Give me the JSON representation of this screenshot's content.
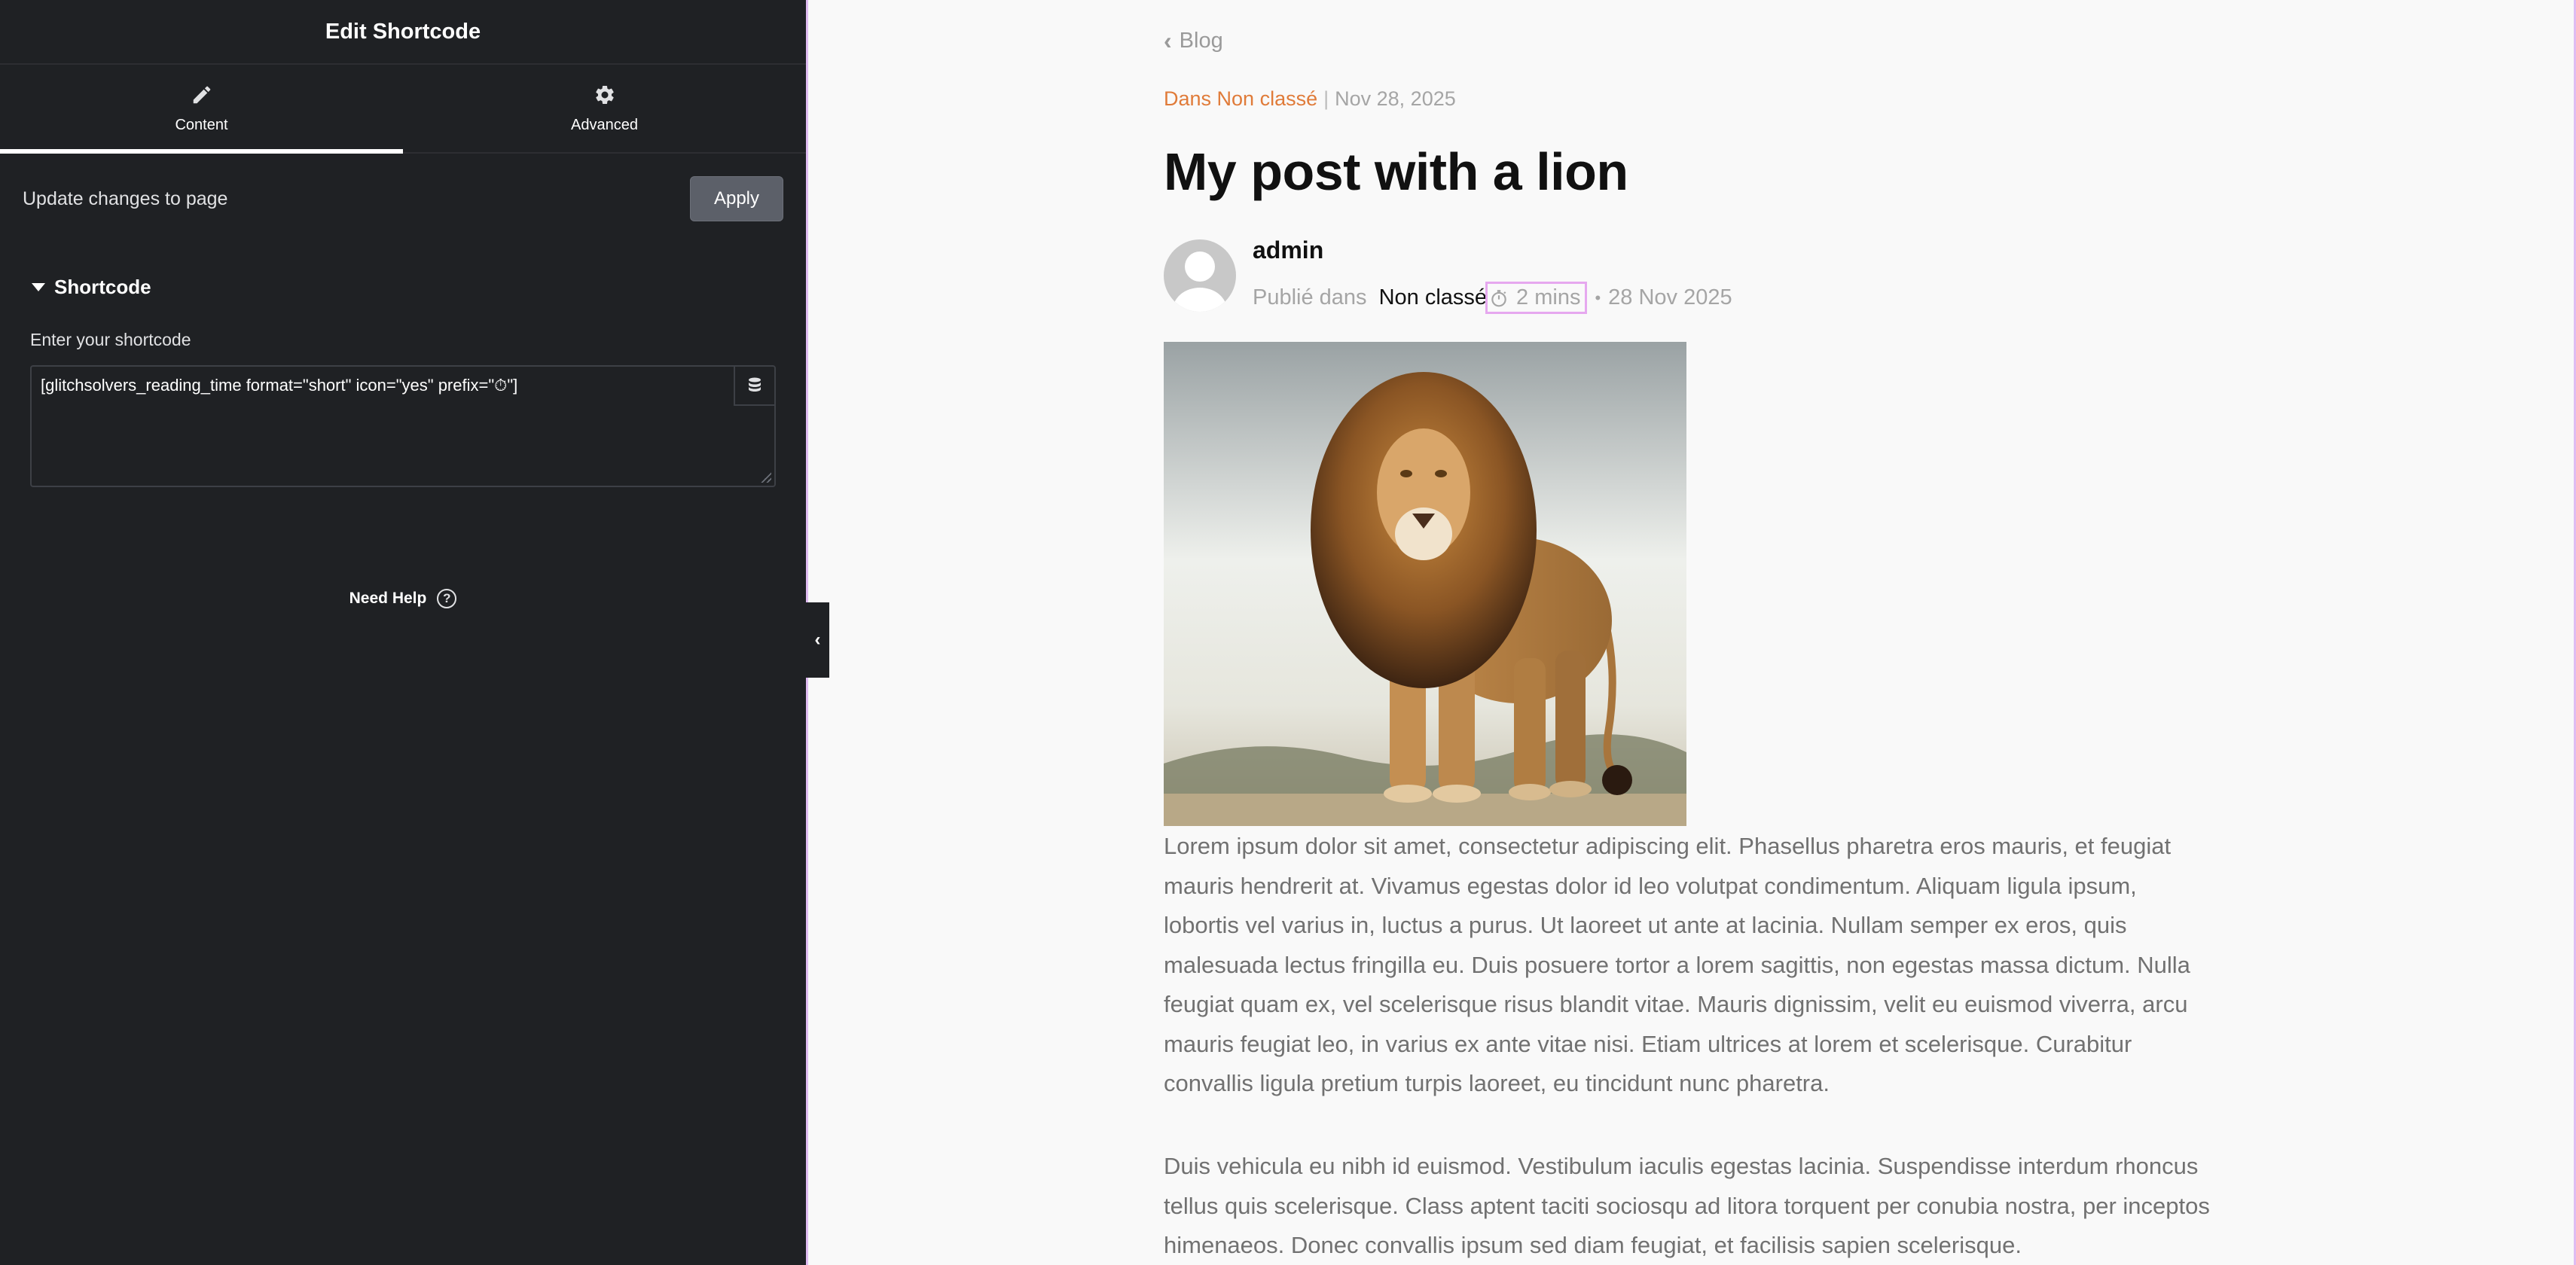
{
  "panel": {
    "title": "Edit Shortcode",
    "tabs": [
      {
        "label": "Content",
        "icon": "pencil-icon",
        "active": true
      },
      {
        "label": "Advanced",
        "icon": "gear-icon",
        "active": false
      }
    ],
    "update_label": "Update changes to page",
    "apply_label": "Apply",
    "section_title": "Shortcode",
    "field_label": "Enter your shortcode",
    "shortcode_value": "[glitchsolvers_reading_time format=\"short\" icon=\"yes\" prefix=\"⏱\"]",
    "help_label": "Need Help",
    "help_icon": "question-circle-icon",
    "collapse_icon": "chevron-left-icon"
  },
  "preview": {
    "back_label": "Blog",
    "category": "Dans Non classé",
    "meta_separator": "|",
    "date": "Nov 28, 2025",
    "title": "My post with a lion",
    "author": "admin",
    "published_in": "Publié dans",
    "byline_category": "Non classé",
    "reading_time": "2 mins",
    "byline_separator": "•",
    "byline_date": "28 Nov 2025",
    "image_subject": "lion",
    "paragraphs": [
      "Lorem ipsum dolor sit amet, consectetur adipiscing elit. Phasellus pharetra eros mauris, et feugiat mauris hendrerit at. Vivamus egestas dolor id leo volutpat condimentum. Aliquam ligula ipsum, lobortis vel varius in, luctus a purus. Ut laoreet ut ante at lacinia. Nullam semper ex eros, quis malesuada lectus fringilla eu. Duis posuere tortor a lorem sagittis, non egestas massa dictum. Nulla feugiat quam ex, vel scelerisque risus blandit vitae. Mauris dignissim, velit eu euismod viverra, arcu mauris feugiat leo, in varius ex ante vitae nisi. Etiam ultrices at lorem et scelerisque. Curabitur convallis ligula pretium turpis laoreet, eu tincidunt nunc pharetra.",
      "Duis vehicula eu nibh id euismod. Vestibulum iaculis egestas lacinia. Suspendisse interdum rhoncus tellus quis scelerisque. Class aptent taciti sociosqu ad litora torquent per conubia nostra, per inceptos himenaeos. Donec convallis ipsum sed diam feugiat, et facilisis sapien scelerisque."
    ]
  },
  "colors": {
    "panel_bg": "#1f2124",
    "accent_category": "#e07b39",
    "reading_time_highlight": "#e6a8ef",
    "preview_bg": "#f9f9f9"
  }
}
